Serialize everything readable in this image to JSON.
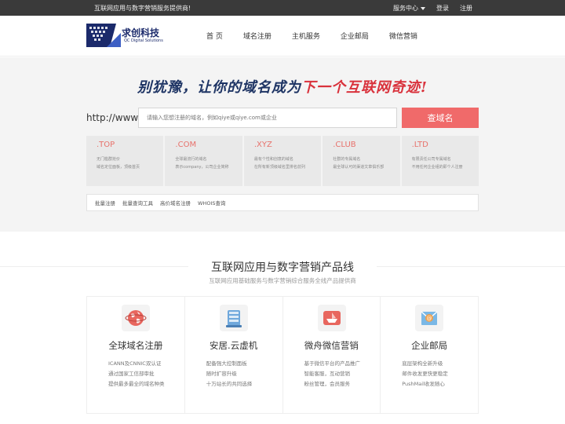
{
  "topbar": {
    "welcome": "互联网应用与数字营销服务提供商!",
    "service_center": "服务中心",
    "login": "登录",
    "register": "注册"
  },
  "logo": {
    "name": "求创科技",
    "subtitle": "QC Digital Solutions"
  },
  "nav": [
    "首 页",
    "域名注册",
    "主机服务",
    "企业邮局",
    "微信营销"
  ],
  "hero": {
    "slogan_left": "别犹豫，让你的域名成为",
    "slogan_right": "下一个互联网奇迹!",
    "prefix": "http://www.",
    "search_placeholder": "请输入您想注册的域名，例如qiye或qiye.com或企业",
    "search_button": "查域名"
  },
  "tlds": [
    {
      "name": ".TOP",
      "line1": "无门槛群抢价",
      "line2": "域名定位面板，顶级首页"
    },
    {
      "name": ".COM",
      "line1": "全球最流行的域名",
      "line2": "表示company，公司企业简称"
    },
    {
      "name": ".XYZ",
      "line1": "最有个性和创意的域名",
      "line2": "在所有新顶级域名里排名前列"
    },
    {
      "name": ".CLUB",
      "line1": "社群的专属域名",
      "line2": "最全球认可的渠道文章俱乐部"
    },
    {
      "name": ".LTD",
      "line1": "有限责任公司专属域名",
      "line2": "不用任何企业组的即个人注册"
    }
  ],
  "tools": [
    "批量注册",
    "批量查询工具",
    "高价域名注册",
    "WHOIS查询"
  ],
  "section": {
    "title": "互联网应用与数字营销产品线",
    "subtitle": "互联网应用基础服务与数字营销综合服务全线产品提供商"
  },
  "products": [
    {
      "name": "全球域名注册",
      "icon": "globe-icon",
      "lines": [
        "ICANN及CNNIC双认证",
        "通过国家工信部审批",
        "提供最多最全的域名种类"
      ]
    },
    {
      "name": "安居.云虚机",
      "icon": "server-icon",
      "lines": [
        "配备强大控制面板",
        "随时扩容升级",
        "十万站长的共同选择"
      ]
    },
    {
      "name": "微舟微信营销",
      "icon": "boat-icon",
      "lines": [
        "基于微信平台的产品推广",
        "智能客服，互动营销",
        "粉丝管理，会员服务"
      ]
    },
    {
      "name": "企业邮局",
      "icon": "email-icon",
      "lines": [
        "底层架构全新升级",
        "邮件收发更快更稳定",
        "PushMail收发随心"
      ]
    }
  ],
  "colors": {
    "accent": "#f06a6a",
    "tld_text": "#e8726c",
    "topbar": "#3a3a3a",
    "slogan_blue": "#1e3464",
    "slogan_red": "#d9323c"
  }
}
